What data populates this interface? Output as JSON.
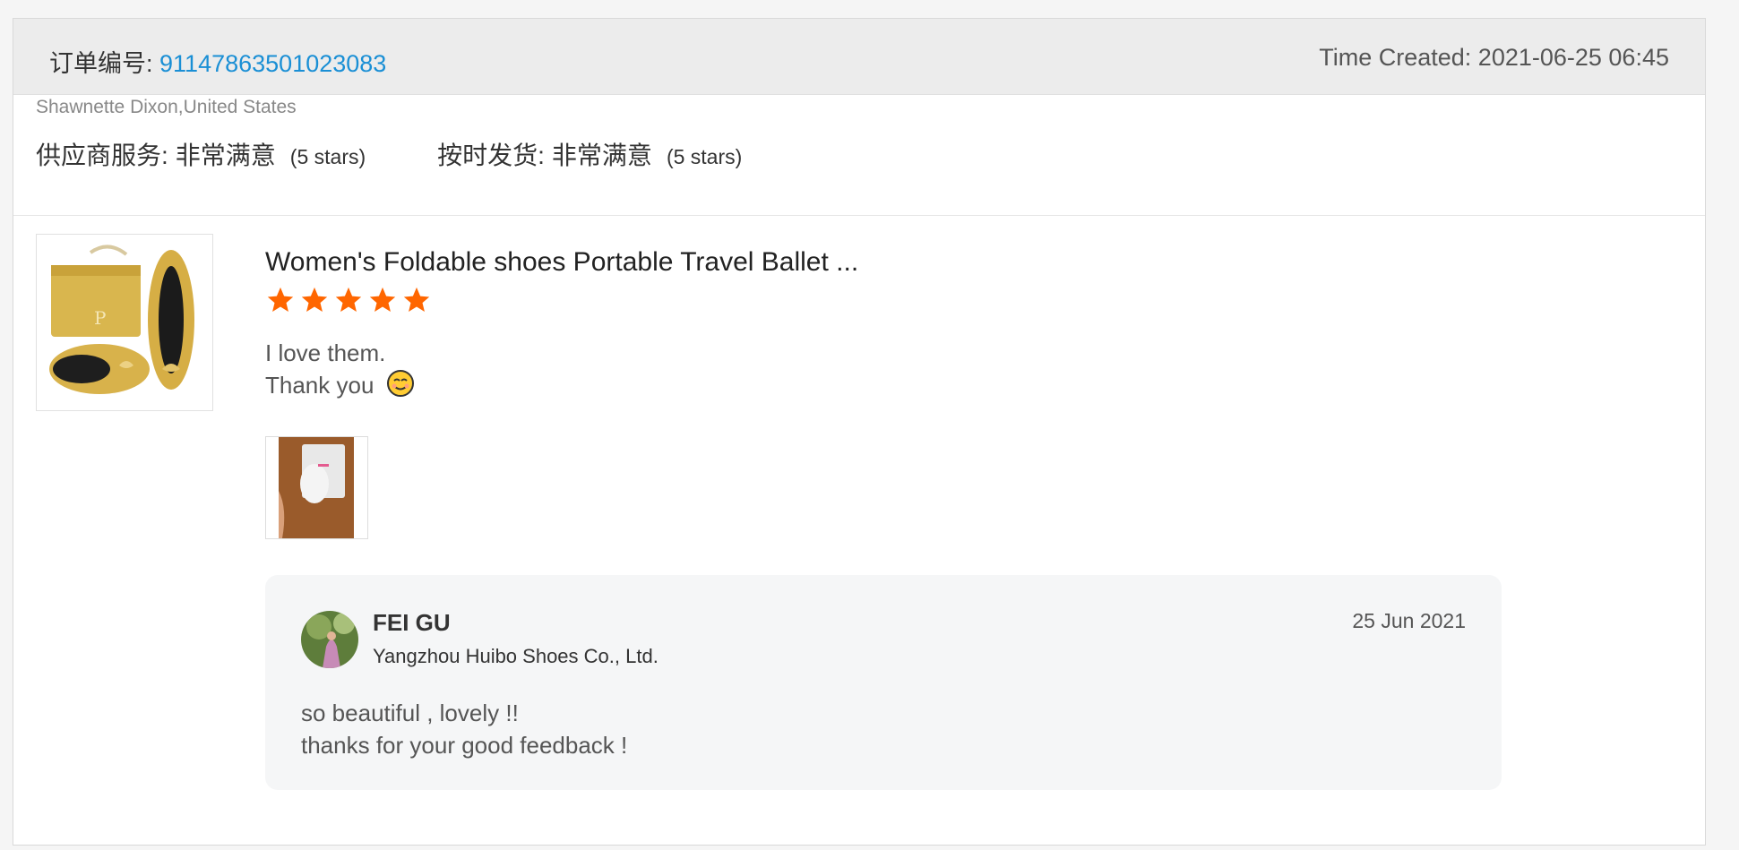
{
  "order": {
    "label": "订单编号:",
    "number": "91147863501023083",
    "time_created": "Time Created: 2021-06-25 06:45"
  },
  "buyer": {
    "name_country": "Shawnette Dixon,United States",
    "ratings": [
      {
        "label": "供应商服务:",
        "value": "非常满意",
        "stars": "(5 stars)"
      },
      {
        "label": "按时发货:",
        "value": "非常满意",
        "stars": "(5 stars)"
      }
    ]
  },
  "product": {
    "title": "Women's Foldable shoes Portable Travel Ballet ...",
    "image_icon": "foldable-ballet-shoes-image",
    "rating": 5
  },
  "review": {
    "line1": "I love them.",
    "line2": "Thank you",
    "emoji": "smiling-face-icon",
    "photo_icon": "buyer-photo-thumbnail"
  },
  "reply": {
    "seller_name": "FEI GU",
    "company": "Yangzhou Huibo Shoes Co., Ltd.",
    "date": "25 Jun 2021",
    "line1": "so beautiful , lovely !!",
    "line2": "thanks for your good feedback !"
  },
  "colors": {
    "link": "#1a8fd5",
    "star": "#ff6600",
    "header_bg": "#ececec",
    "reply_bg": "#f5f6f7"
  }
}
